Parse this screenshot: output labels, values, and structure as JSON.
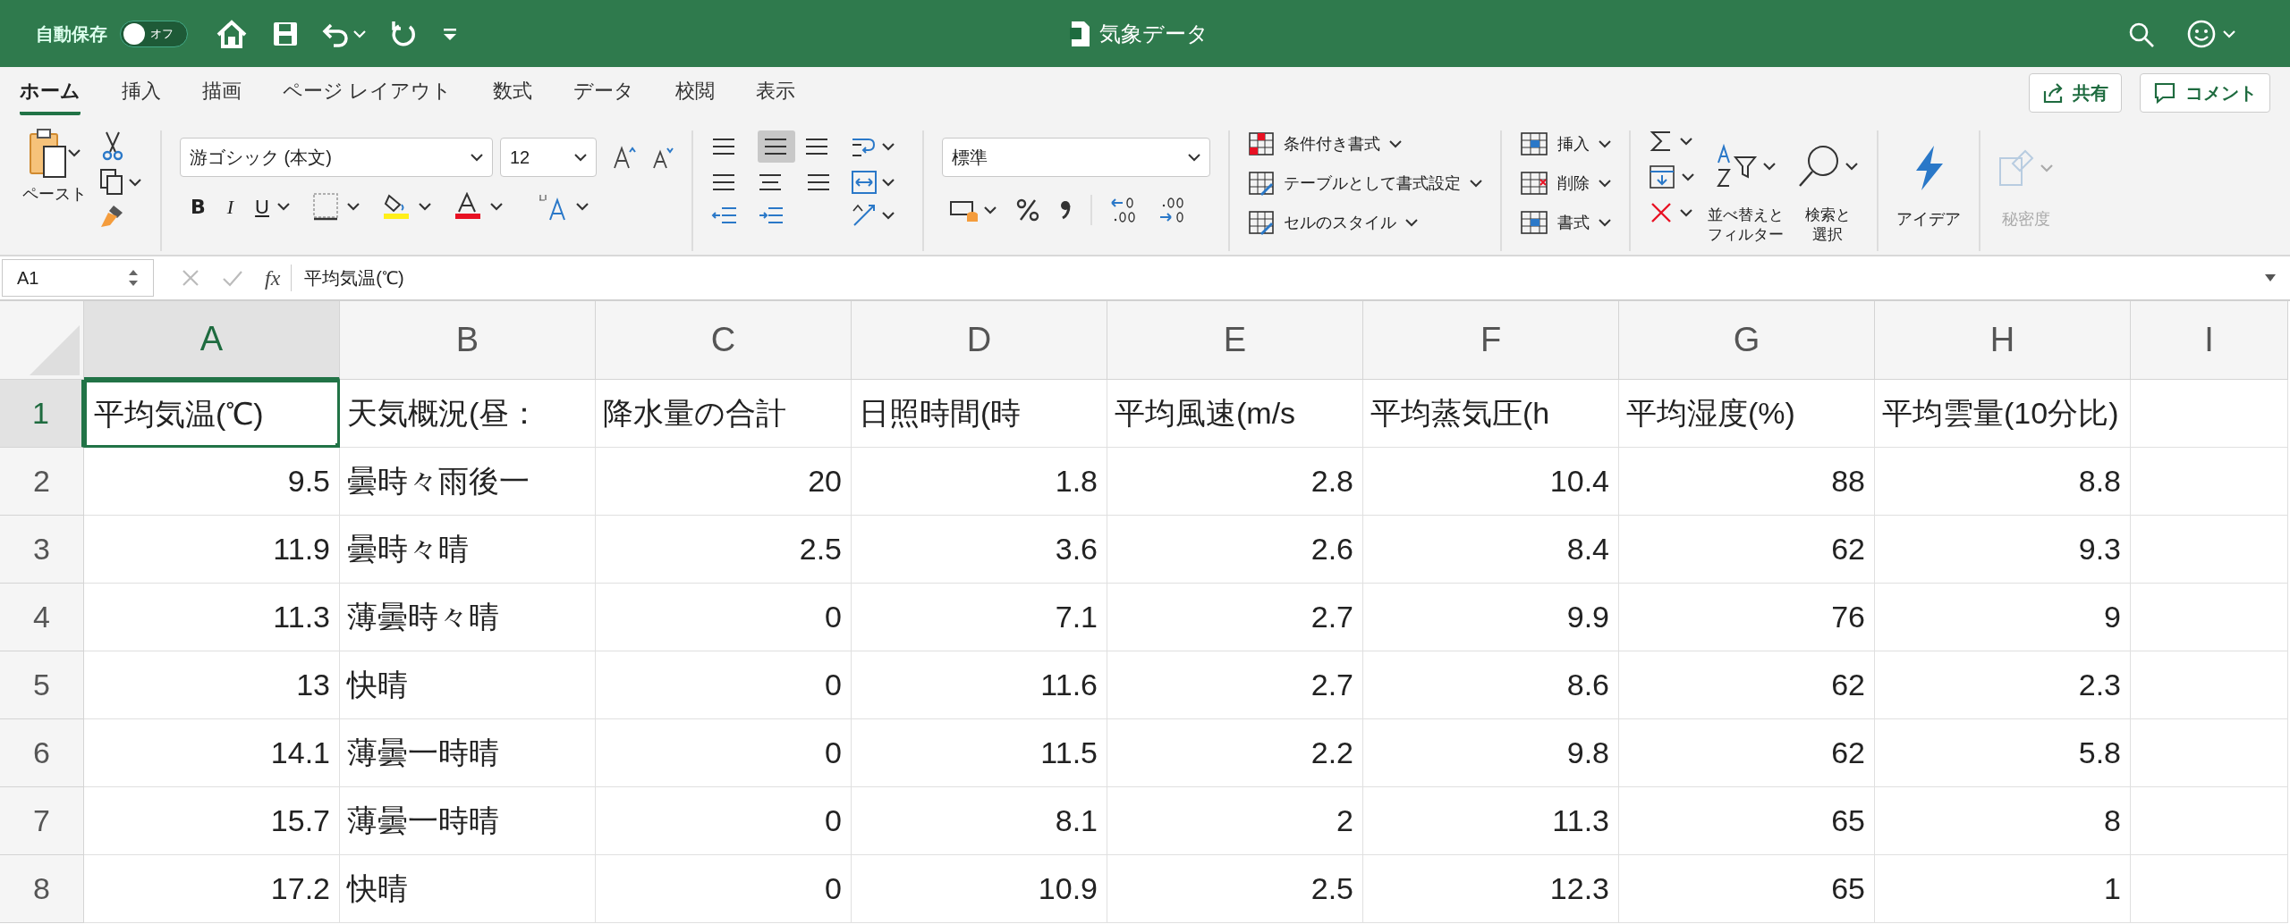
{
  "title_bar": {
    "autosave_label": "自動保存",
    "autosave_toggle": {
      "label": "オフ",
      "on": false
    },
    "title": "気象データ"
  },
  "ribbon_tabs": [
    {
      "label": "ホーム",
      "selected": true
    },
    {
      "label": "挿入",
      "selected": false
    },
    {
      "label": "描画",
      "selected": false
    },
    {
      "label": "ページ レイアウト",
      "selected": false
    },
    {
      "label": "数式",
      "selected": false
    },
    {
      "label": "データ",
      "selected": false
    },
    {
      "label": "校閲",
      "selected": false
    },
    {
      "label": "表示",
      "selected": false
    }
  ],
  "share_button": "共有",
  "comment_button": "コメント",
  "ribbon": {
    "paste": "ペースト",
    "font_name": "游ゴシック (本文)",
    "font_size": "12",
    "bold": "B",
    "italic": "I",
    "underline": "U",
    "number_format": "標準",
    "styles": [
      "条件付き書式",
      "テーブルとして書式設定",
      "セルのスタイル"
    ],
    "cells": [
      "挿入",
      "削除",
      "書式"
    ],
    "sort_filter": [
      "並べ替えと",
      "フィルター"
    ],
    "find_select": [
      "検索と",
      "選択"
    ],
    "ideas": "アイデア",
    "sensitivity": {
      "label": "秘密度",
      "disabled": true
    }
  },
  "formula_bar": {
    "name_box": "A1",
    "function_button": "fx",
    "formula": "平均気温(℃)"
  },
  "sheet": {
    "columns": [
      {
        "label": "A",
        "selected": true
      },
      {
        "label": "B",
        "selected": false
      },
      {
        "label": "C",
        "selected": false
      },
      {
        "label": "D",
        "selected": false
      },
      {
        "label": "E",
        "selected": false
      },
      {
        "label": "F",
        "selected": false
      },
      {
        "label": "G",
        "selected": false
      },
      {
        "label": "H",
        "selected": false
      },
      {
        "label": "I",
        "selected": false
      }
    ],
    "rows": [
      {
        "number": "1",
        "selected": true,
        "cells": [
          {
            "text": "平均気温(℃)",
            "kind": "text",
            "active": true
          },
          {
            "text": "天気概況(昼：",
            "kind": "text"
          },
          {
            "text": "降水量の合計",
            "kind": "text"
          },
          {
            "text": "日照時間(時",
            "kind": "text"
          },
          {
            "text": "平均風速(m/s",
            "kind": "text"
          },
          {
            "text": "平均蒸気圧(h",
            "kind": "text"
          },
          {
            "text": "平均湿度(%)",
            "kind": "text"
          },
          {
            "text": "平均雲量(10分比)",
            "kind": "text"
          }
        ]
      },
      {
        "number": "2",
        "selected": false,
        "cells": [
          {
            "text": "9.5",
            "kind": "number"
          },
          {
            "text": "曇時々雨後一",
            "kind": "text"
          },
          {
            "text": "20",
            "kind": "number"
          },
          {
            "text": "1.8",
            "kind": "number"
          },
          {
            "text": "2.8",
            "kind": "number"
          },
          {
            "text": "10.4",
            "kind": "number"
          },
          {
            "text": "88",
            "kind": "number"
          },
          {
            "text": "8.8",
            "kind": "number"
          }
        ]
      },
      {
        "number": "3",
        "selected": false,
        "cells": [
          {
            "text": "11.9",
            "kind": "number"
          },
          {
            "text": "曇時々晴",
            "kind": "text"
          },
          {
            "text": "2.5",
            "kind": "number"
          },
          {
            "text": "3.6",
            "kind": "number"
          },
          {
            "text": "2.6",
            "kind": "number"
          },
          {
            "text": "8.4",
            "kind": "number"
          },
          {
            "text": "62",
            "kind": "number"
          },
          {
            "text": "9.3",
            "kind": "number"
          }
        ]
      },
      {
        "number": "4",
        "selected": false,
        "cells": [
          {
            "text": "11.3",
            "kind": "number"
          },
          {
            "text": "薄曇時々晴",
            "kind": "text"
          },
          {
            "text": "0",
            "kind": "number"
          },
          {
            "text": "7.1",
            "kind": "number"
          },
          {
            "text": "2.7",
            "kind": "number"
          },
          {
            "text": "9.9",
            "kind": "number"
          },
          {
            "text": "76",
            "kind": "number"
          },
          {
            "text": "9",
            "kind": "number"
          }
        ]
      },
      {
        "number": "5",
        "selected": false,
        "cells": [
          {
            "text": "13",
            "kind": "number"
          },
          {
            "text": "快晴",
            "kind": "text"
          },
          {
            "text": "0",
            "kind": "number"
          },
          {
            "text": "11.6",
            "kind": "number"
          },
          {
            "text": "2.7",
            "kind": "number"
          },
          {
            "text": "8.6",
            "kind": "number"
          },
          {
            "text": "62",
            "kind": "number"
          },
          {
            "text": "2.3",
            "kind": "number"
          }
        ]
      },
      {
        "number": "6",
        "selected": false,
        "cells": [
          {
            "text": "14.1",
            "kind": "number"
          },
          {
            "text": "薄曇一時晴",
            "kind": "text"
          },
          {
            "text": "0",
            "kind": "number"
          },
          {
            "text": "11.5",
            "kind": "number"
          },
          {
            "text": "2.2",
            "kind": "number"
          },
          {
            "text": "9.8",
            "kind": "number"
          },
          {
            "text": "62",
            "kind": "number"
          },
          {
            "text": "5.8",
            "kind": "number"
          }
        ]
      },
      {
        "number": "7",
        "selected": false,
        "cells": [
          {
            "text": "15.7",
            "kind": "number"
          },
          {
            "text": "薄曇一時晴",
            "kind": "text"
          },
          {
            "text": "0",
            "kind": "number"
          },
          {
            "text": "8.1",
            "kind": "number"
          },
          {
            "text": "2",
            "kind": "number"
          },
          {
            "text": "11.3",
            "kind": "number"
          },
          {
            "text": "65",
            "kind": "number"
          },
          {
            "text": "8",
            "kind": "number"
          }
        ]
      },
      {
        "number": "8",
        "selected": false,
        "cells": [
          {
            "text": "17.2",
            "kind": "number"
          },
          {
            "text": "快晴",
            "kind": "text"
          },
          {
            "text": "0",
            "kind": "number"
          },
          {
            "text": "10.9",
            "kind": "number"
          },
          {
            "text": "2.5",
            "kind": "number"
          },
          {
            "text": "12.3",
            "kind": "number"
          },
          {
            "text": "65",
            "kind": "number"
          },
          {
            "text": "1",
            "kind": "number"
          }
        ]
      }
    ]
  }
}
